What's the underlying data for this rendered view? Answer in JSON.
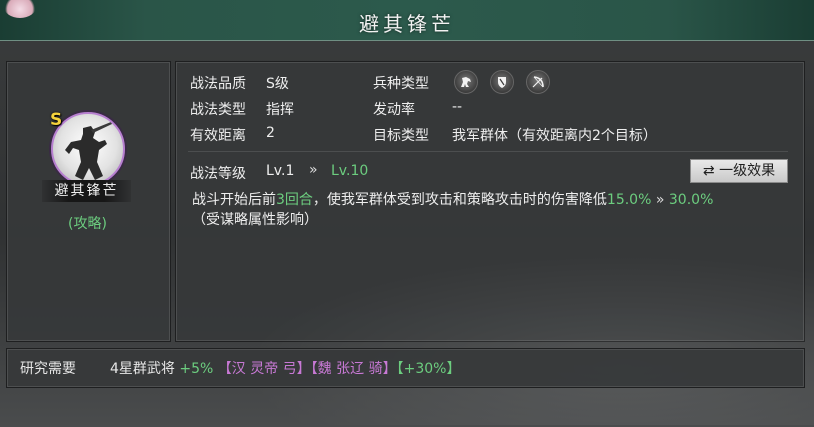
{
  "window": {
    "title": "避其锋芒"
  },
  "skill": {
    "grade_badge": "S",
    "name": "避其锋芒",
    "tag": "(攻略)"
  },
  "info": {
    "quality_label": "战法品质",
    "quality_value": "S级",
    "type_label": "战法类型",
    "type_value": "指挥",
    "range_label": "有效距离",
    "range_value": "2",
    "troop_label": "兵种类型",
    "troop_icons": [
      "cavalry-icon",
      "shield-icon",
      "bow-icon"
    ],
    "trigger_label": "发动率",
    "trigger_value": "--",
    "target_label": "目标类型",
    "target_value": "我军群体（有效距离内2个目标）"
  },
  "level": {
    "label": "战法等级",
    "current": "Lv.1",
    "arrow": "»",
    "max": "Lv.10",
    "effect_button": "⇄ 一级效果"
  },
  "description": {
    "part1": "战斗开始后前",
    "rounds": "3回合",
    "part2": "，使我军群体受到攻击和策略攻击时的伤害降低",
    "value_from": "15.0%",
    "arrow": "»",
    "value_to": "30.0%",
    "note": "（受谋略属性影响）"
  },
  "research": {
    "label": "研究需要",
    "requirement": "4星群武将",
    "bonus": "+5%",
    "hero1": "【汉 灵帝 弓】",
    "hero2": "【魏 张辽 骑】",
    "bonus2": "【+30%】"
  },
  "colors": {
    "accent_green": "#6ccd7f",
    "grade_gold": "#f5d23c",
    "hero_purple": "#c879d5",
    "title_bar": "#2c5a4c"
  }
}
